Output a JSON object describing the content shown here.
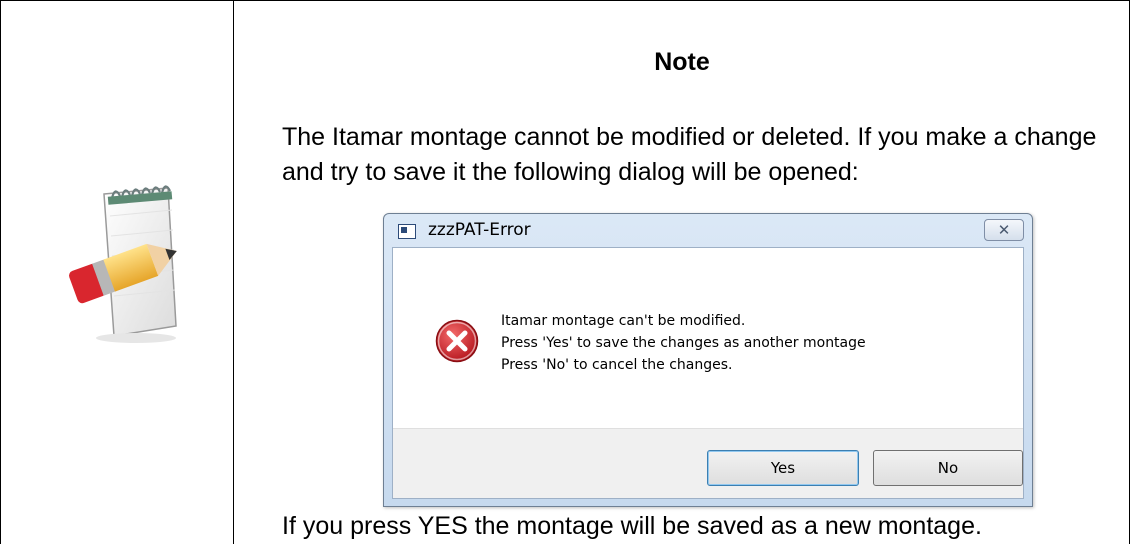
{
  "note": {
    "title": "Note",
    "body": "The Itamar montage cannot be modified or deleted. If you make a change and try to save it the following dialog will be opened:",
    "footer": "If you press YES the montage will be saved as a new montage.",
    "icon": "notepad-pencil-icon"
  },
  "dialog": {
    "title": "zzzPAT-Error",
    "close_symbol": "✕",
    "icon": "error-icon",
    "message_lines": [
      "Itamar montage can't be modified.",
      "Press 'Yes' to save the changes as another montage",
      "Press 'No' to cancel the changes."
    ],
    "buttons": {
      "yes": "Yes",
      "no": "No"
    }
  },
  "colors": {
    "error_red": "#d2232a",
    "dialog_frame": "#c6d9ee",
    "button_bar": "#f0f0f0"
  }
}
